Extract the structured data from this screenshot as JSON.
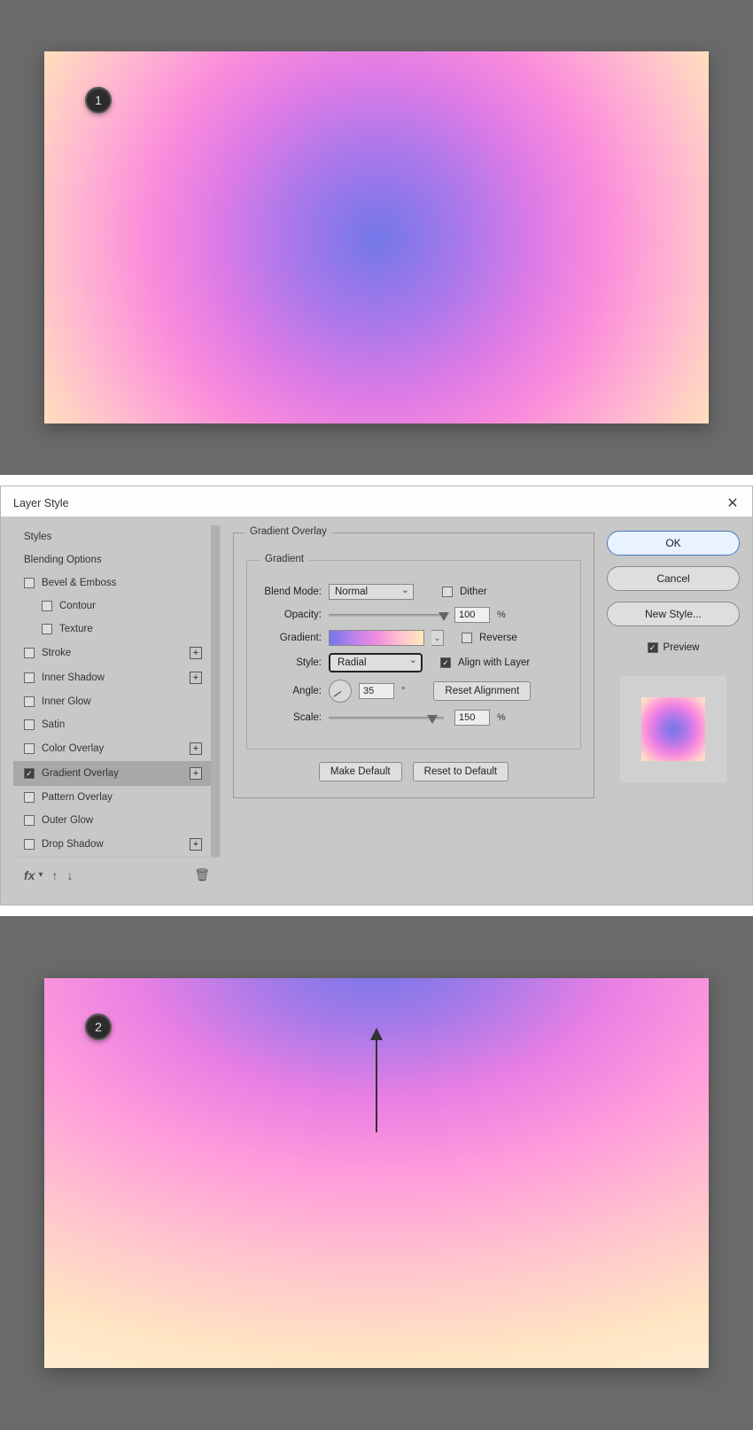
{
  "step1_badge": "1",
  "step2_badge": "2",
  "dialog_title": "Layer Style",
  "sidebar": {
    "rows": [
      {
        "label": "Styles",
        "no_check": true
      },
      {
        "label": "Blending Options",
        "no_check": true
      },
      {
        "label": "Bevel & Emboss"
      },
      {
        "label": "Contour",
        "indent": true
      },
      {
        "label": "Texture",
        "indent": true
      },
      {
        "label": "Stroke",
        "add": true
      },
      {
        "label": "Inner Shadow",
        "add": true
      },
      {
        "label": "Inner Glow"
      },
      {
        "label": "Satin"
      },
      {
        "label": "Color Overlay",
        "add": true
      },
      {
        "label": "Gradient Overlay",
        "checked": true,
        "selected": true,
        "add": true
      },
      {
        "label": "Pattern Overlay"
      },
      {
        "label": "Outer Glow"
      },
      {
        "label": "Drop Shadow",
        "add": true
      }
    ],
    "fx_glyph": "fx"
  },
  "settings": {
    "group_title": "Gradient Overlay",
    "sub_title": "Gradient",
    "labels": {
      "blend_mode": "Blend Mode:",
      "opacity": "Opacity:",
      "gradient": "Gradient:",
      "style": "Style:",
      "angle": "Angle:",
      "scale": "Scale:"
    },
    "blend_mode_value": "Normal",
    "dither_label": "Dither",
    "opacity_value": "100",
    "reverse_label": "Reverse",
    "style_value": "Radial",
    "align_label": "Align with Layer",
    "angle_value": "35",
    "deg_symbol": "°",
    "reset_alignment": "Reset Alignment",
    "scale_value": "150",
    "pct": "%",
    "make_default": "Make Default",
    "reset_default": "Reset to Default"
  },
  "right": {
    "ok": "OK",
    "cancel": "Cancel",
    "new_style": "New Style...",
    "preview": "Preview"
  }
}
